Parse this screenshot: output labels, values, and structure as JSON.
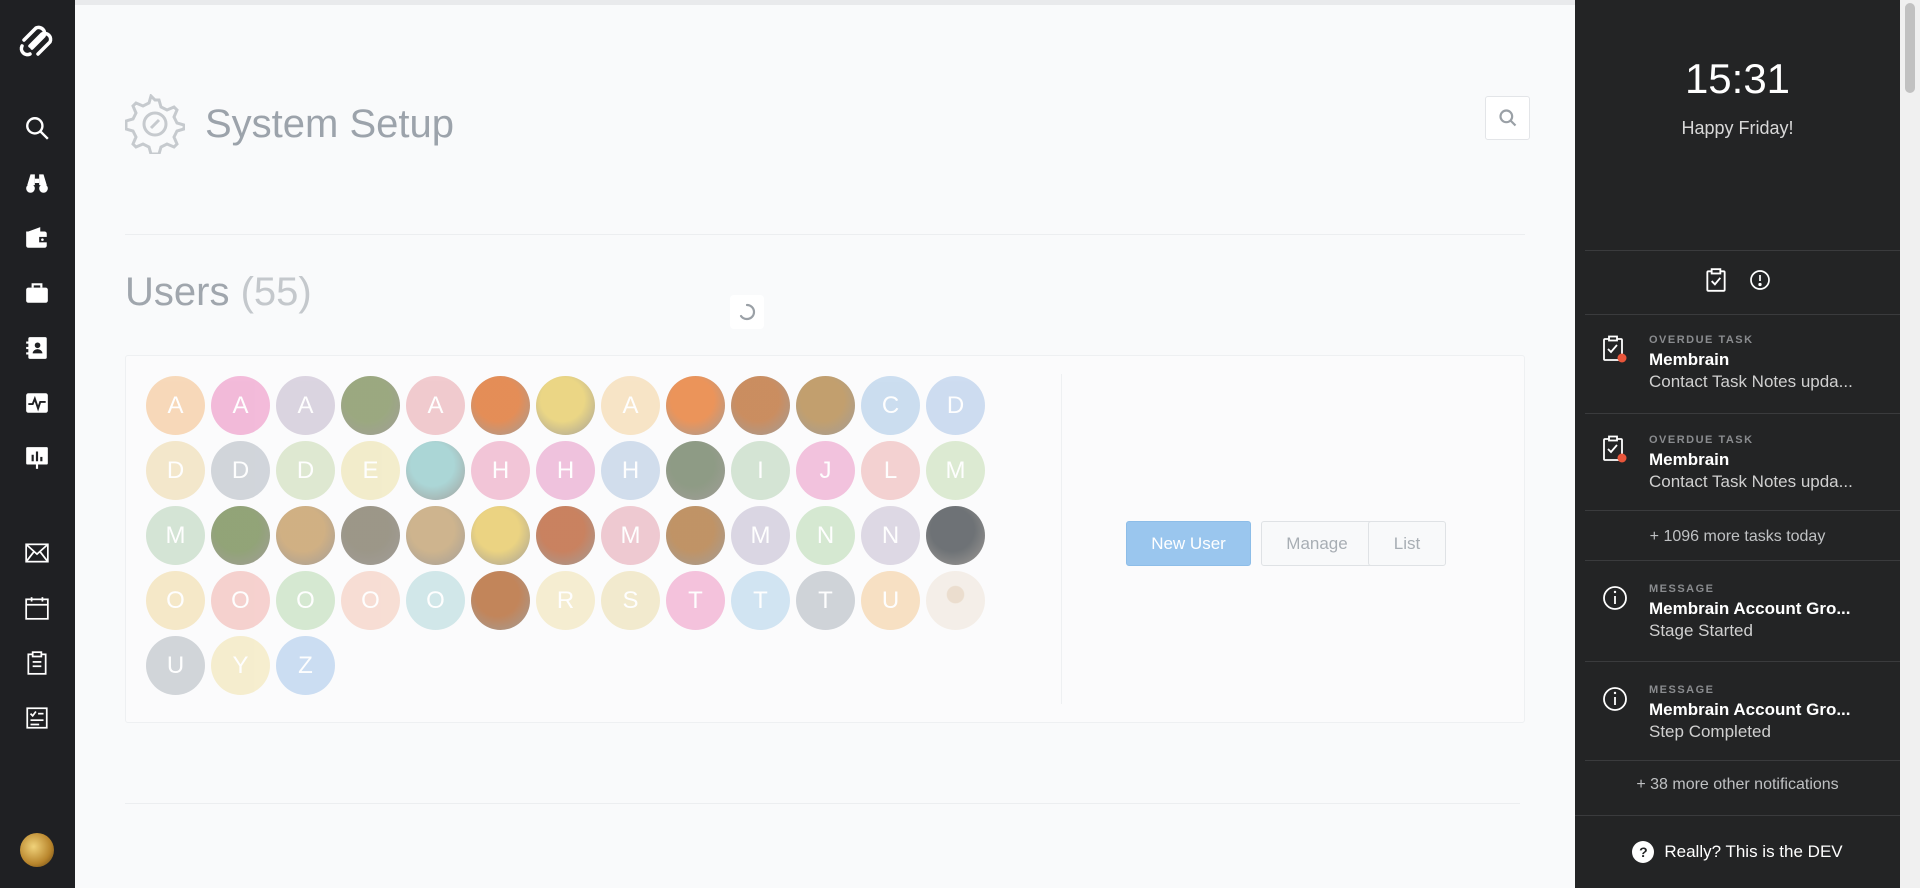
{
  "nav": {
    "items": [
      {
        "name": "search-icon",
        "label": "Search"
      },
      {
        "name": "binoculars-icon",
        "label": "Prospects"
      },
      {
        "name": "wallet-icon",
        "label": "Deals"
      },
      {
        "name": "briefcase-icon",
        "label": "Accounts"
      },
      {
        "name": "contacts-icon",
        "label": "Contacts"
      },
      {
        "name": "activity-icon",
        "label": "Activity"
      },
      {
        "name": "presentation-icon",
        "label": "Reports"
      },
      {
        "name": "mail-icon",
        "label": "Mail"
      },
      {
        "name": "calendar-icon",
        "label": "Calendar"
      },
      {
        "name": "clipboard-icon",
        "label": "Tasks"
      },
      {
        "name": "checklist-icon",
        "label": "Checklist"
      }
    ]
  },
  "page": {
    "title": "System Setup"
  },
  "users": {
    "heading": "Users",
    "count": "(55)",
    "avatars": [
      {
        "letter": "A",
        "color": "#f7d7b6"
      },
      {
        "letter": "A",
        "color": "#f2b7d8"
      },
      {
        "letter": "A",
        "color": "#d9d2df"
      },
      {
        "letter": "",
        "color": "#8a9a6a",
        "photo": true
      },
      {
        "letter": "A",
        "color": "#f0c8cc"
      },
      {
        "letter": "",
        "color": "#e07a3a",
        "photo": true
      },
      {
        "letter": "",
        "color": "#e8d070",
        "photo": true
      },
      {
        "letter": "A",
        "color": "#f7e3c4"
      },
      {
        "letter": "",
        "color": "#e8823e",
        "photo": true
      },
      {
        "letter": "",
        "color": "#c27a45",
        "photo": true
      },
      {
        "letter": "",
        "color": "#b88f55",
        "photo": true
      },
      {
        "letter": "C",
        "color": "#c9dcef"
      },
      {
        "letter": "D",
        "color": "#cbdbf0"
      },
      {
        "letter": "D",
        "color": "#f3e6c9"
      },
      {
        "letter": "D",
        "color": "#cfd3d9"
      },
      {
        "letter": "D",
        "color": "#dde8cf"
      },
      {
        "letter": "E",
        "color": "#f2ecc9"
      },
      {
        "letter": "",
        "color": "#9dcfcf",
        "photo": true
      },
      {
        "letter": "H",
        "color": "#f2c3d6"
      },
      {
        "letter": "H",
        "color": "#efbfdc"
      },
      {
        "letter": "H",
        "color": "#cfdcec"
      },
      {
        "letter": "",
        "color": "#7b8a70",
        "photo": true
      },
      {
        "letter": "I",
        "color": "#d2e3d2"
      },
      {
        "letter": "J",
        "color": "#f2c0dc"
      },
      {
        "letter": "L",
        "color": "#f3cfcf"
      },
      {
        "letter": "M",
        "color": "#dbead0"
      },
      {
        "letter": "M",
        "color": "#d2e3d3"
      },
      {
        "letter": "",
        "color": "#7f9460",
        "photo": true
      },
      {
        "letter": "",
        "color": "#c9a36e",
        "photo": true
      },
      {
        "letter": "",
        "color": "#8b8574",
        "photo": true
      },
      {
        "letter": "",
        "color": "#c6a87a",
        "photo": true
      },
      {
        "letter": "",
        "color": "#e8cc6c",
        "photo": true
      },
      {
        "letter": "",
        "color": "#c06c44",
        "photo": true
      },
      {
        "letter": "M",
        "color": "#eec7cf"
      },
      {
        "letter": "",
        "color": "#b5814c",
        "photo": true
      },
      {
        "letter": "M",
        "color": "#d9d5e2"
      },
      {
        "letter": "N",
        "color": "#d3e8cf"
      },
      {
        "letter": "N",
        "color": "#dcd7e3"
      },
      {
        "letter": "",
        "color": "#555a5e",
        "photo": true
      },
      {
        "letter": "O",
        "color": "#f5e7c6"
      },
      {
        "letter": "O",
        "color": "#f5cfcc"
      },
      {
        "letter": "O",
        "color": "#d3e8cf"
      },
      {
        "letter": "O",
        "color": "#f7dcd2"
      },
      {
        "letter": "O",
        "color": "#cfe6e8"
      },
      {
        "letter": "",
        "color": "#b8703e",
        "photo": true
      },
      {
        "letter": "R",
        "color": "#f5edcf"
      },
      {
        "letter": "S",
        "color": "#f2eacc"
      },
      {
        "letter": "T",
        "color": "#f4bfdb"
      },
      {
        "letter": "T",
        "color": "#cfe3f2"
      },
      {
        "letter": "T",
        "color": "#cdd1d7"
      },
      {
        "letter": "U",
        "color": "#f7dfc0"
      },
      {
        "letter": "",
        "color": "#f3ece4",
        "photo": true,
        "figure": true
      },
      {
        "letter": "U",
        "color": "#cfd3d8"
      },
      {
        "letter": "Y",
        "color": "#f5edcc"
      },
      {
        "letter": "Z",
        "color": "#c9dcf2"
      }
    ],
    "new_user_label": "New User",
    "manage_label": "Manage",
    "list_label": "List"
  },
  "sidebar": {
    "time": "15:31",
    "greeting": "Happy Friday!",
    "notifications": [
      {
        "type": "OVERDUE TASK",
        "title": "Membrain",
        "text": "Contact Task Notes upda...",
        "icon": "clipboard-alert-icon"
      },
      {
        "type": "OVERDUE TASK",
        "title": "Membrain",
        "text": "Contact Task Notes upda...",
        "icon": "clipboard-alert-icon"
      },
      {
        "type": "MESSAGE",
        "title": "Membrain Account Gro...",
        "text": "Stage Started",
        "icon": "info-icon"
      },
      {
        "type": "MESSAGE",
        "title": "Membrain Account Gro...",
        "text": "Step Completed",
        "icon": "info-icon"
      }
    ],
    "more_tasks": "+ 1096 more tasks today",
    "more_notifications": "+ 38 more other notifications",
    "help_text": "Really? This is the DEV"
  }
}
